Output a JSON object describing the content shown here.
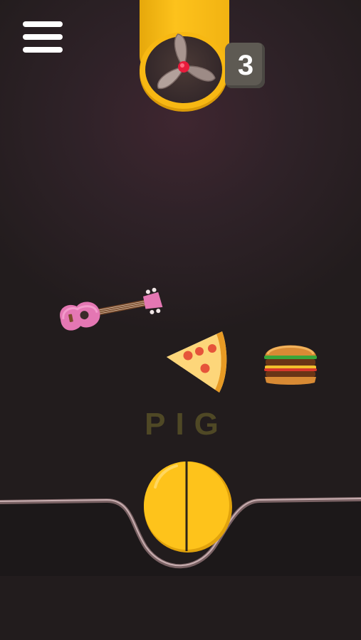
{
  "hud": {
    "menu_icon": "hamburger-menu-icon",
    "item_counter": "3"
  },
  "fan": {
    "icon": "fan-icon",
    "colors": {
      "housing": "#f7b813",
      "blades": "#9b8a86",
      "hub": "#e81c3c"
    }
  },
  "items": [
    {
      "name": "ukulele",
      "icon": "ukulele-icon",
      "color": "#e477b3"
    },
    {
      "name": "pizza-slice",
      "icon": "pizza-slice-icon",
      "color": "#f0a52a"
    },
    {
      "name": "burger",
      "icon": "burger-icon",
      "color": "#c9772a"
    }
  ],
  "target_word": "PIG",
  "ball": {
    "icon": "yellow-ball-icon",
    "color": "#fec31b"
  },
  "track": {
    "color": "#6b5557"
  }
}
